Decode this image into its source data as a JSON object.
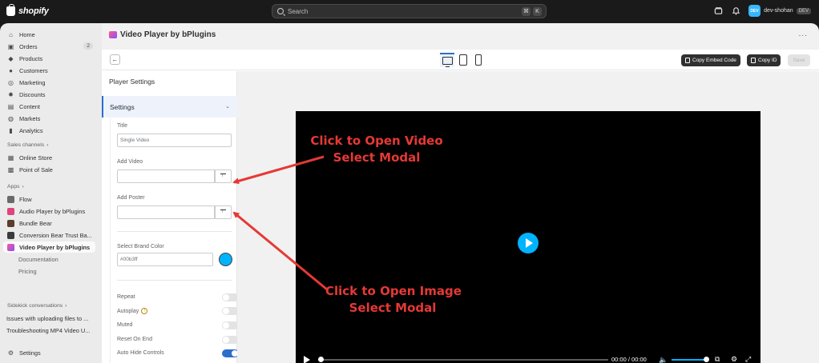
{
  "topbar": {
    "logo_text": "shopify",
    "search_placeholder": "Search",
    "shortcut_keys": [
      "⌘",
      "K"
    ],
    "user_initials": "DEV",
    "user_name": "dev-shohan",
    "user_badge": "DEV"
  },
  "sidebar": {
    "main_items": [
      {
        "label": "Home",
        "icon": "home-icon"
      },
      {
        "label": "Orders",
        "icon": "orders-icon",
        "count": "2"
      },
      {
        "label": "Products",
        "icon": "tag-icon"
      },
      {
        "label": "Customers",
        "icon": "person-icon"
      },
      {
        "label": "Marketing",
        "icon": "target-icon"
      },
      {
        "label": "Discounts",
        "icon": "discount-icon"
      },
      {
        "label": "Content",
        "icon": "content-icon"
      },
      {
        "label": "Markets",
        "icon": "globe-icon"
      },
      {
        "label": "Analytics",
        "icon": "bar-chart-icon"
      }
    ],
    "sales_channels_label": "Sales channels",
    "sales_channels": [
      {
        "label": "Online Store",
        "icon": "store-icon"
      },
      {
        "label": "Point of Sale",
        "icon": "pos-icon"
      }
    ],
    "apps_label": "Apps",
    "apps": [
      {
        "label": "Flow",
        "color": "#6a6a6a"
      },
      {
        "label": "Audio Player by bPlugins",
        "color": "#e0447c"
      },
      {
        "label": "Bundle Bear",
        "color": "#5b3e2b"
      },
      {
        "label": "Conversion Bear Trust Ba...",
        "color": "#3b3b3b"
      },
      {
        "label": "Video Player by bPlugins",
        "color": "#8a4dff"
      }
    ],
    "app_subitems": [
      "Documentation",
      "Pricing"
    ],
    "sidekick_label": "Sidekick conversations",
    "conversations": [
      "Issues with uploading files to ...",
      "Troubleshooting MP4 Video U..."
    ],
    "settings_label": "Settings"
  },
  "page": {
    "title": "Video Player by bPlugins",
    "more_label": "..."
  },
  "toolbar": {
    "copy_embed_label": "Copy Embed Code",
    "copy_id_label": "Copy ID",
    "save_label": "Save"
  },
  "panel": {
    "title": "Player Settings",
    "section_label": "Settings",
    "title_label": "Title",
    "title_value": "Single Video",
    "add_video_label": "Add Video",
    "add_poster_label": "Add Poster",
    "brand_color_label": "Select Brand Color",
    "brand_color_value": "#00b3ff",
    "toggles": [
      {
        "label": "Repeat",
        "on": false
      },
      {
        "label": "Autoplay",
        "on": false
      },
      {
        "label": "Muted",
        "on": false
      },
      {
        "label": "Reset On End",
        "on": false
      },
      {
        "label": "Auto Hide Controls",
        "on": true
      }
    ]
  },
  "player": {
    "time": "00:00 / 00:00",
    "accent": "#00b3ff"
  },
  "annotations": {
    "video_line1": "Click to Open Video",
    "video_line2": "Select Modal",
    "image_line1": "Click to Open Image",
    "image_line2": "Select Modal"
  }
}
